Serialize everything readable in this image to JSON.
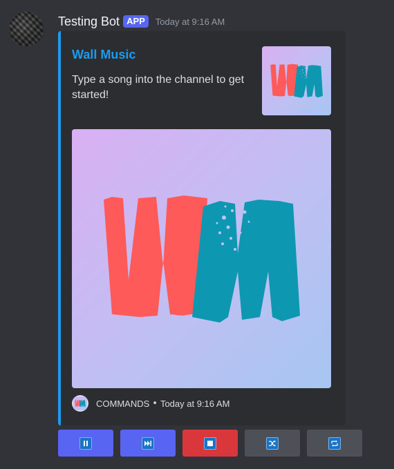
{
  "message": {
    "username": "Testing Bot",
    "app_tag": "APP",
    "timestamp": "Today at 9:16 AM"
  },
  "embed": {
    "title": "Wall Music",
    "description": "Type a song into the channel to get started!",
    "accent_color": "#1a9cf1",
    "logo_text": "WM",
    "footer": {
      "label": "COMMANDS",
      "separator": "•",
      "timestamp": "Today at 9:16 AM"
    }
  },
  "buttons": [
    {
      "name": "pause",
      "icon": "pause-icon",
      "style": "primary",
      "color": "#5865f2"
    },
    {
      "name": "skip",
      "icon": "skip-icon",
      "style": "primary",
      "color": "#5865f2"
    },
    {
      "name": "stop",
      "icon": "stop-icon",
      "style": "danger",
      "color": "#da373c"
    },
    {
      "name": "shuffle",
      "icon": "shuffle-icon",
      "style": "secondary",
      "color": "#4e5058"
    },
    {
      "name": "repeat",
      "icon": "repeat-icon",
      "style": "secondary",
      "color": "#4e5058"
    }
  ],
  "colors": {
    "background": "#323338",
    "embed_bg": "#2b2d31",
    "logo_red": "#ff5a5a",
    "logo_teal": "#0e97b0"
  }
}
